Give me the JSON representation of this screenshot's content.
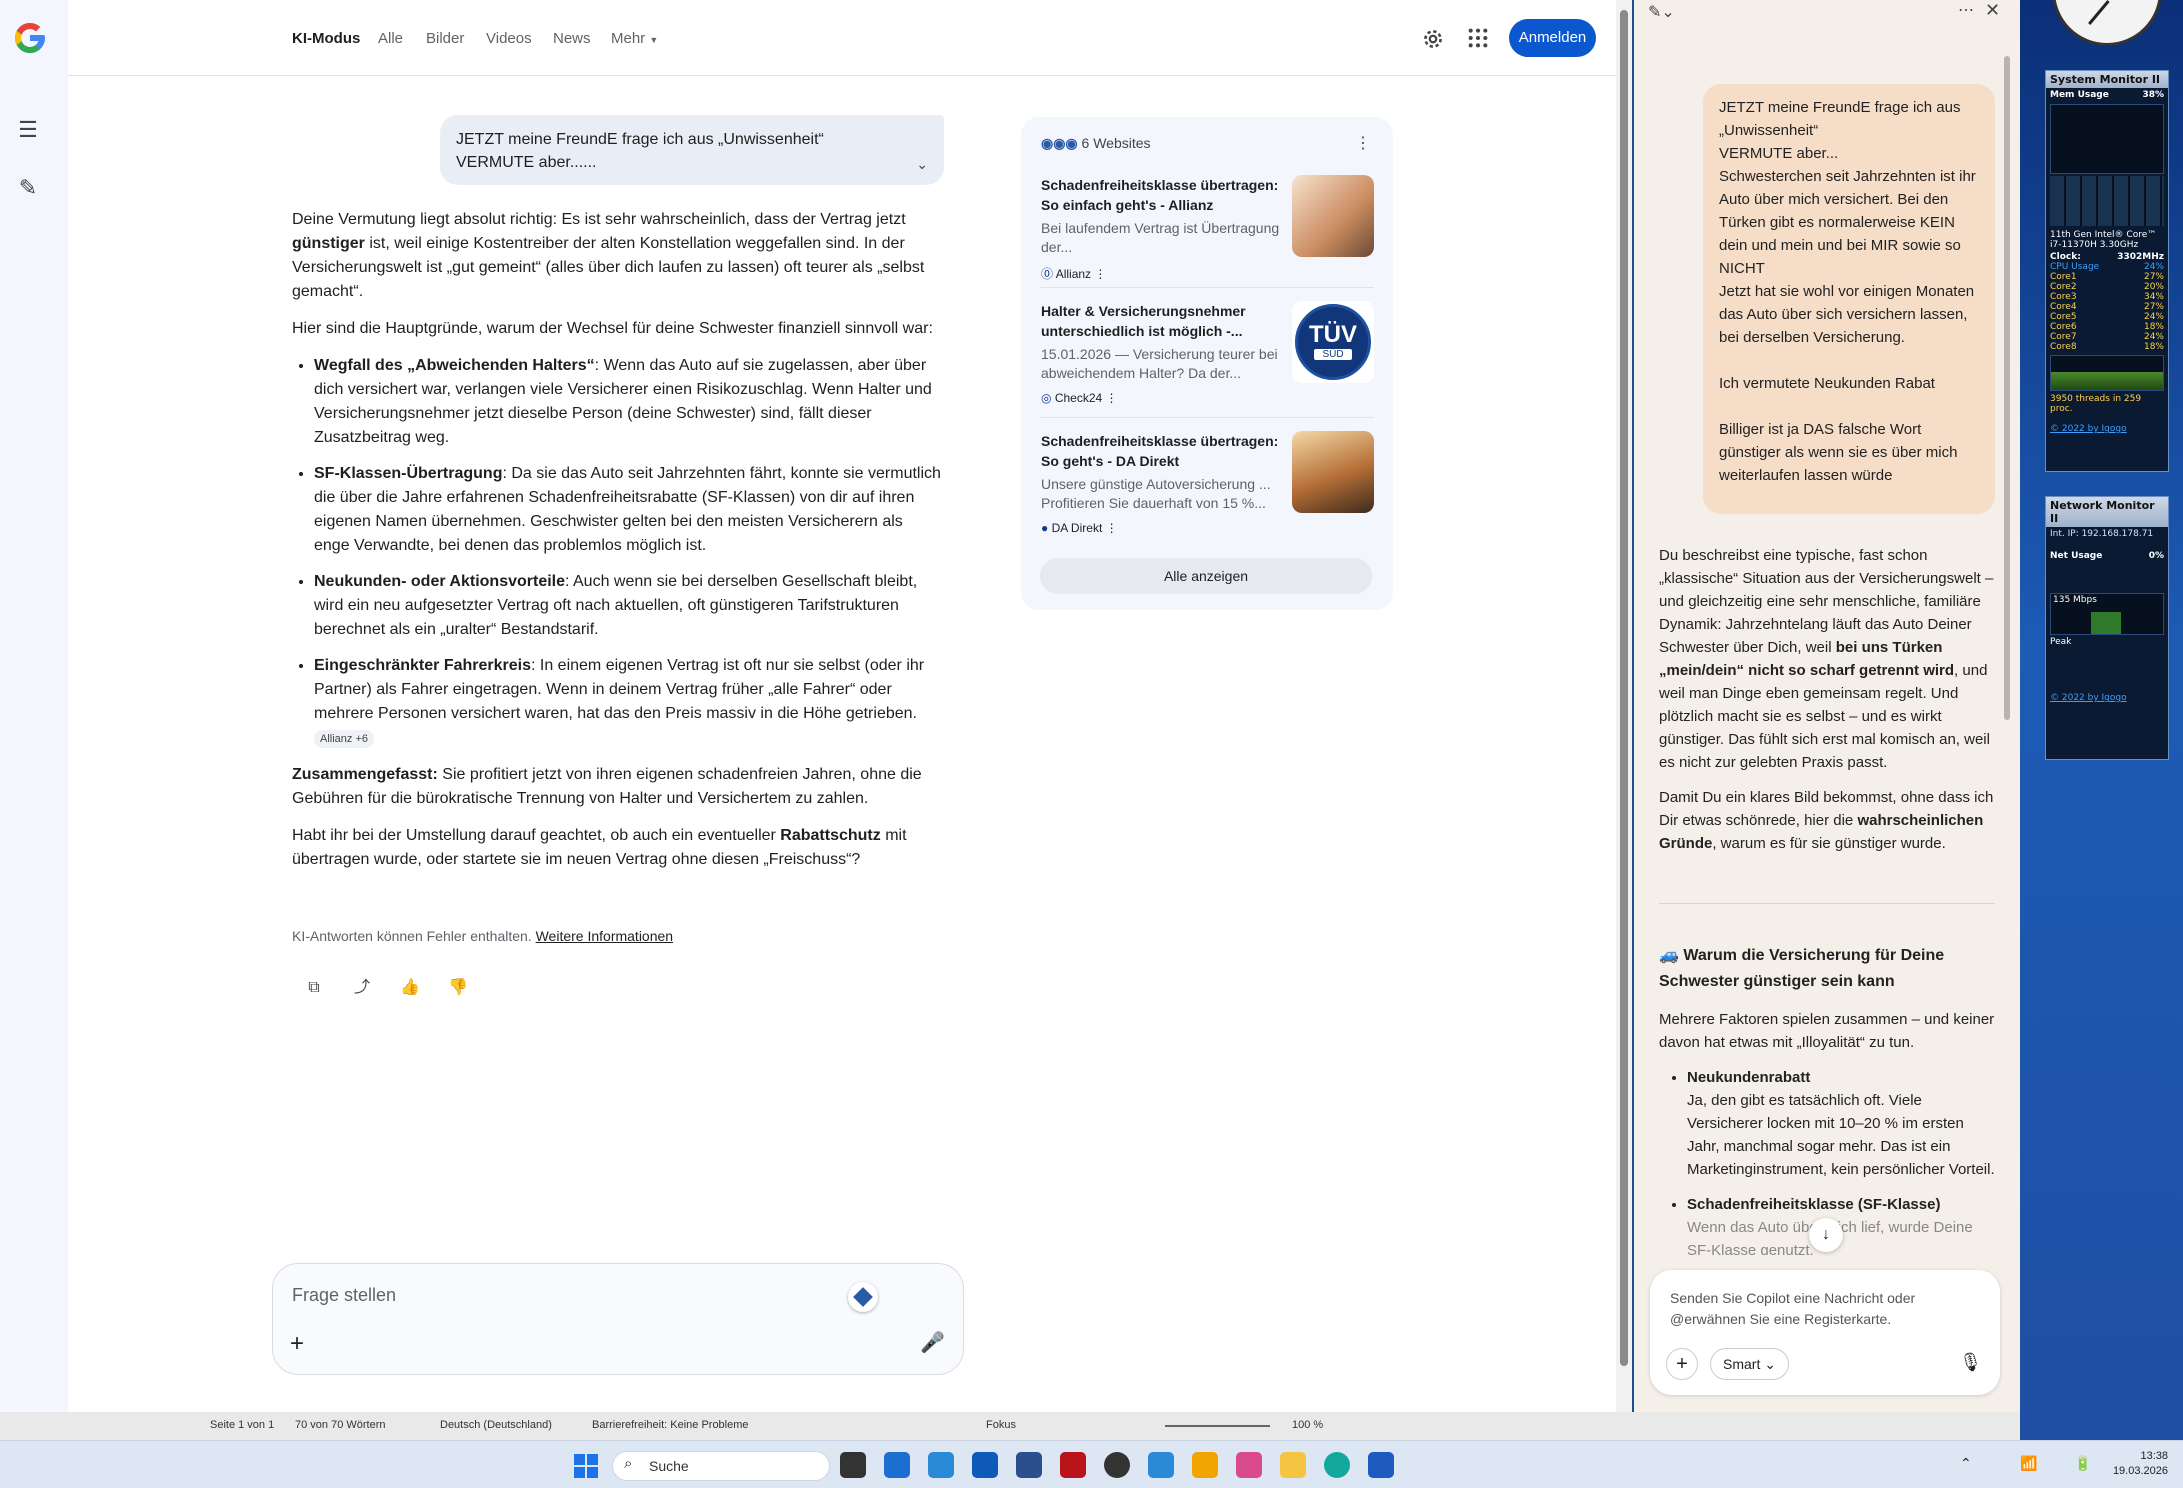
{
  "google": {
    "tabs": [
      "KI-Modus",
      "Alle",
      "Bilder",
      "Videos",
      "News",
      "Mehr"
    ],
    "signin": "Anmelden",
    "query_line1": "JETZT meine FreundE frage ich aus „Unwissenheit“",
    "query_line2": "VERMUTE aber......",
    "answer": {
      "p1_a": "Deine Vermutung liegt absolut richtig: Es ist sehr wahrscheinlich, dass der Vertrag jetzt ",
      "p1_b": "günstiger",
      "p1_c": " ist, weil einige Kostentreiber der alten Konstellation weggefallen sind. In der Versicherungswelt ist „gut gemeint“ (alles über dich laufen zu lassen) oft teurer als „selbst gemacht“.",
      "p2": "Hier sind die Hauptgründe, warum der Wechsel für deine Schwester finanziell sinnvoll war:",
      "bullets": [
        {
          "bold": "Wegfall des „Abweichenden Halters“",
          "text": ": Wenn das Auto auf sie zugelassen, aber über dich versichert war, verlangen viele Versicherer einen Risikozuschlag. Wenn Halter und Versicherungsnehmer jetzt dieselbe Person (deine Schwester) sind, fällt dieser Zusatzbeitrag weg."
        },
        {
          "bold": "SF-Klassen-Übertragung",
          "text": ": Da sie das Auto seit Jahrzehnten fährt, konnte sie vermutlich die über die Jahre erfahrenen Schadenfreiheitsrabatte (SF-Klassen) von dir auf ihren eigenen Namen übernehmen. Geschwister gelten bei den meisten Versicherern als enge Verwandte, bei denen das problemlos möglich ist."
        },
        {
          "bold": "Neukunden- oder Aktionsvorteile",
          "text": ": Auch wenn sie bei derselben Gesellschaft bleibt, wird ein neu aufgesetzter Vertrag oft nach aktuellen, oft günstigeren Tarifstrukturen berechnet als ein „uralter“ Bestandstarif."
        },
        {
          "bold": "Eingeschränkter Fahrerkreis",
          "text": ": In einem eigenen Vertrag ist oft nur sie selbst (oder ihr Partner) als Fahrer eingetragen. Wenn in deinem Vertrag früher „alle Fahrer“ oder mehrere Personen versichert waren, hat das den Preis massiv in die Höhe getrieben."
        }
      ],
      "chip": "Allianz +6",
      "p3_bold": "Zusammengefasst:",
      "p3": " Sie profitiert jetzt von ihren eigenen schadenfreien Jahren, ohne die Gebühren für die bürokratische Trennung von Halter und Versichertem zu zahlen.",
      "p4_a": "Habt ihr bei der Umstellung darauf geachtet, ob auch ein eventueller ",
      "p4_b": "Rabattschutz",
      "p4_c": " mit übertragen wurde, oder startete sie im neuen Vertrag ohne diesen „Freischuss“?"
    },
    "disclaimer": "KI-Antworten können Fehler enthalten.",
    "disclaimer_link": "Weitere Informationen",
    "sources": {
      "header": "6 Websites",
      "items": [
        {
          "title": "Schadenfreiheitsklasse übertragen: So einfach geht's - Allianz",
          "snippet": "Bei laufendem Vertrag ist Übertragung der...",
          "site": "Allianz"
        },
        {
          "title": "Halter & Versicherungsnehmer unterschiedlich ist möglich -...",
          "snippet": "15.01.2026 — Versicherung teurer bei abweichendem Halter? Da der...",
          "site": "Check24"
        },
        {
          "title": "Schadenfreiheitsklasse übertragen: So geht's - DA Direkt",
          "snippet": "Unsere günstige Autoversicherung ... Profitieren Sie dauerhaft von 15 %...",
          "site": "DA Direkt"
        }
      ],
      "show_all": "Alle anzeigen",
      "tuv_text": "TÜV",
      "tuv_sub": "SÜD"
    },
    "ask_placeholder": "Frage stellen"
  },
  "copilot": {
    "user_message": [
      "JETZT meine FreundE frage ich aus „Unwissenheit“",
      "VERMUTE aber...",
      "Schwesterchen seit Jahrzehnten ist ihr Auto über mich versichert. Bei den Türken gibt es normalerweise KEIN dein und mein und bei MIR sowie so NICHT",
      "Jetzt hat sie wohl vor einigen Monaten das Auto über sich versichern lassen, bei derselben Versicherung.",
      "",
      "Ich vermutete Neukunden Rabat",
      "",
      "Billiger ist ja DAS falsche Wort günstiger als wenn sie es über mich weiterlaufen lassen würde"
    ],
    "a1_a": "Du beschreibst eine typische, fast schon „klassische“ Situation aus der Versicherungswelt – und gleichzeitig eine sehr menschliche, familiäre Dynamik: Jahrzehntelang läuft das Auto Deiner Schwester über Dich, weil ",
    "a1_b": "bei uns Türken „mein/dein“ nicht so scharf getrennt wird",
    "a1_c": ", und weil man Dinge eben gemeinsam regelt. Und plötzlich macht sie es selbst – und es wirkt günstiger. Das fühlt sich erst mal komisch an, weil es nicht zur gelebten Praxis passt.",
    "a2_a": "Damit Du ein klares Bild bekommst, ohne dass ich Dir etwas schönrede, hier die ",
    "a2_b": "wahrscheinlichen Gründe",
    "a2_c": ", warum es für sie günstiger wurde.",
    "heading": "🚙 Warum die Versicherung für Deine Schwester günstiger sein kann",
    "a3": "Mehrere Faktoren spielen zusammen – und keiner davon hat etwas mit „Illoyalität“ zu tun.",
    "b1_title": "Neukundenrabatt",
    "b1_text": "Ja, den gibt es tatsächlich oft. Viele Versicherer locken mit 10–20 % im ersten Jahr, manchmal sogar mehr. Das ist ein Marketinginstrument, kein persönlicher Vorteil.",
    "b2_title": "Schadenfreiheitsklasse (SF-Klasse)",
    "b2_text": "Wenn das Auto über Dich lief, wurde Deine SF-Klasse genutzt.",
    "input_placeholder": "Senden Sie Copilot eine Nachricht oder @erwähnen Sie eine Registerkarte.",
    "mode": "Smart"
  },
  "word_status": {
    "page": "Seite 1 von 1",
    "words": "70 von 70 Wörtern",
    "lang": "Deutsch (Deutschland)",
    "access": "Barrierefreiheit: Keine Probleme",
    "focus": "Fokus",
    "zoom": "100 %"
  },
  "taskbar": {
    "search": "Suche",
    "time": "13:38",
    "date": "19.03.2026"
  },
  "gadgets": {
    "sysmon_title": "System Monitor II",
    "mem": "Mem Usage",
    "mem_pct": "38%",
    "cpu_name": "11th Gen Intel® Core™ i7-11370H 3.30GHz",
    "clock": "Clock:",
    "clock_val": "3302MHz",
    "cpu_usage": "CPU Usage",
    "cpu_pct": "24%",
    "cores": [
      "Core1",
      "Core2",
      "Core3",
      "Core4",
      "Core5",
      "Core6",
      "Core7",
      "Core8"
    ],
    "core_vals": [
      "27%",
      "20%",
      "34%",
      "27%",
      "24%",
      "18%",
      "24%",
      "18%"
    ],
    "threads": "3950 threads in 259 proc.",
    "netmon_title": "Network Monitor II",
    "int_ip": "Int. IP: 192.168.178.71",
    "net_usage": "Net Usage",
    "net_pct": "0%",
    "speed": "135 Mbps",
    "peak": "Peak",
    "footer": "© 2022 by Igogo"
  },
  "colors": {
    "google_blue": "#0b57d0",
    "copilot_bg": "#f5efe9",
    "user_bubble": "#f5ddc8"
  }
}
